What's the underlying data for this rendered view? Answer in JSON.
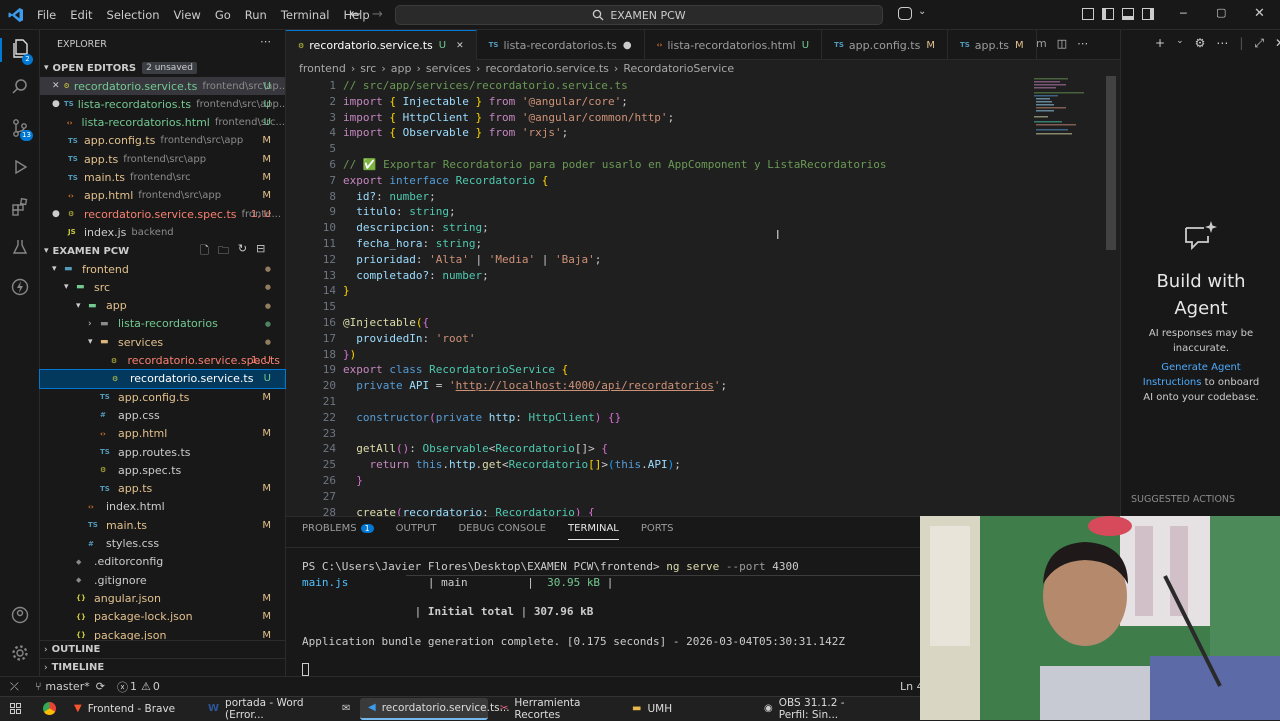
{
  "menu": [
    "File",
    "Edit",
    "Selection",
    "View",
    "Go",
    "Run",
    "Terminal",
    "Help"
  ],
  "search": {
    "text": "EXAMEN PCW"
  },
  "explorer": {
    "title": "EXPLORER",
    "open_editors": "OPEN EDITORS",
    "unsaved": "2 unsaved",
    "folder": "EXAMEN PCW",
    "outline": "OUTLINE",
    "timeline": "TIMELINE"
  },
  "open_editors": [
    {
      "name": "recordatorio.service.ts",
      "path": "frontend\\src\\ap...",
      "status": "U",
      "color": "#73c991"
    },
    {
      "name": "lista-recordatorios.ts",
      "path": "frontend\\src\\app...",
      "status": "U",
      "color": "#73c991"
    },
    {
      "name": "lista-recordatorios.html",
      "path": "frontend\\src...",
      "status": "U",
      "color": "#73c991"
    },
    {
      "name": "app.config.ts",
      "path": "frontend\\src\\app",
      "status": "M",
      "color": "#e2c08d"
    },
    {
      "name": "app.ts",
      "path": "frontend\\src\\app",
      "status": "M",
      "color": "#e2c08d"
    },
    {
      "name": "main.ts",
      "path": "frontend\\src",
      "status": "M",
      "color": "#e2c08d"
    },
    {
      "name": "app.html",
      "path": "frontend\\src\\app",
      "status": "M",
      "color": "#e2c08d"
    },
    {
      "name": "recordatorio.service.spec.ts",
      "path": "fronte...",
      "status": "1, U",
      "color": "#f88070"
    },
    {
      "name": "index.js",
      "path": "backend",
      "status": "",
      "color": "#ccc"
    }
  ],
  "tree": [
    {
      "name": "frontend",
      "indent": 1,
      "status": "",
      "color": "#e2c08d"
    },
    {
      "name": "src",
      "indent": 2,
      "status": "",
      "color": "#e2c08d"
    },
    {
      "name": "app",
      "indent": 3,
      "status": "",
      "color": "#e2c08d"
    },
    {
      "name": "lista-recordatorios",
      "indent": 4,
      "status": "",
      "color": "#73c991"
    },
    {
      "name": "services",
      "indent": 4,
      "status": "",
      "color": "#e2c08d"
    },
    {
      "name": "recordatorio.service.spec.ts",
      "indent": 5,
      "status": "1, U",
      "color": "#f88070"
    },
    {
      "name": "recordatorio.service.ts",
      "indent": 5,
      "status": "U",
      "color": "#73c991"
    },
    {
      "name": "app.config.ts",
      "indent": 4,
      "status": "M",
      "color": "#e2c08d"
    },
    {
      "name": "app.css",
      "indent": 4,
      "status": "",
      "color": "#ccc"
    },
    {
      "name": "app.html",
      "indent": 4,
      "status": "M",
      "color": "#e2c08d"
    },
    {
      "name": "app.routes.ts",
      "indent": 4,
      "status": "",
      "color": "#ccc"
    },
    {
      "name": "app.spec.ts",
      "indent": 4,
      "status": "",
      "color": "#ccc"
    },
    {
      "name": "app.ts",
      "indent": 4,
      "status": "M",
      "color": "#e2c08d"
    },
    {
      "name": "index.html",
      "indent": 3,
      "status": "",
      "color": "#ccc"
    },
    {
      "name": "main.ts",
      "indent": 3,
      "status": "M",
      "color": "#e2c08d"
    },
    {
      "name": "styles.css",
      "indent": 3,
      "status": "",
      "color": "#ccc"
    },
    {
      "name": ".editorconfig",
      "indent": 2,
      "status": "",
      "color": "#ccc"
    },
    {
      "name": ".gitignore",
      "indent": 2,
      "status": "",
      "color": "#ccc"
    },
    {
      "name": "angular.json",
      "indent": 2,
      "status": "M",
      "color": "#e2c08d"
    },
    {
      "name": "package-lock.json",
      "indent": 2,
      "status": "M",
      "color": "#e2c08d"
    },
    {
      "name": "package.json",
      "indent": 2,
      "status": "M",
      "color": "#e2c08d"
    }
  ],
  "tabs": [
    {
      "label": "recordatorio.service.ts",
      "status": "U",
      "active": true
    },
    {
      "label": "lista-recordatorios.ts",
      "status": "●",
      "active": false
    },
    {
      "label": "lista-recordatorios.html",
      "status": "U",
      "active": false
    },
    {
      "label": "app.config.ts",
      "status": "M",
      "active": false
    },
    {
      "label": "app.ts",
      "status": "M",
      "active": false
    }
  ],
  "breadcrumb": [
    "frontend",
    "src",
    "app",
    "services",
    "recordatorio.service.ts",
    "RecordatorioService"
  ],
  "code_lines": [
    "<span class='cm'>// src/app/services/recordatorio.service.ts</span>",
    "<span class='kw2'>import</span> <span class='br'>{</span> <span class='vr'>Injectable</span> <span class='br'>}</span> <span class='kw2'>from</span> <span class='str'>'@angular/core'</span>;",
    "<span class='kw2'>import</span> <span class='br'>{</span> <span class='vr'>HttpClient</span> <span class='br'>}</span> <span class='kw2'>from</span> <span class='str'>'@angular/common/http'</span>;",
    "<span class='kw2'>import</span> <span class='br'>{</span> <span class='vr'>Observable</span> <span class='br'>}</span> <span class='kw2'>from</span> <span class='str'>'rxjs'</span>;",
    "",
    "<span class='cm'>// ✅ Exportar Recordatorio para poder usarlo en AppComponent y ListaRecordatorios</span>",
    "<span class='kw2'>export</span> <span class='kw'>interface</span> <span class='ty'>Recordatorio</span> <span class='br'>{</span>",
    "  <span class='vr'>id?</span>: <span class='ty'>number</span>;",
    "  <span class='vr'>titulo</span>: <span class='ty'>string</span>;",
    "  <span class='vr'>descripcion</span>: <span class='ty'>string</span>;",
    "  <span class='vr'>fecha_hora</span>: <span class='ty'>string</span>;",
    "  <span class='vr'>prioridad</span>: <span class='str'>'Alta'</span> | <span class='str'>'Media'</span> | <span class='str'>'Baja'</span>;",
    "  <span class='vr'>completado?</span>: <span class='ty'>number</span>;",
    "<span class='br'>}</span>",
    "",
    "<span class='fn'>@Injectable</span><span class='br'>(</span><span class='br2'>{</span>",
    "  <span class='vr'>providedIn</span>: <span class='str'>'root'</span>",
    "<span class='br2'>}</span><span class='br'>)</span>",
    "<span class='kw2'>export</span> <span class='kw'>class</span> <span class='ty'>RecordatorioService</span> <span class='br'>{</span>",
    "  <span class='kw'>private</span> <span class='vr'>API</span> = <span class='str'>'<u>http://localhost:4000/api/recordatorios</u>'</span>;",
    "",
    "  <span class='kw'>constructor</span><span class='br2'>(</span><span class='kw'>private</span> <span class='vr'>http</span>: <span class='ty'>HttpClient</span><span class='br2'>)</span> <span class='br2'>{}</span>",
    "",
    "  <span class='fn'>getAll</span><span class='br2'>()</span>: <span class='ty'>Observable</span>&lt;<span class='ty'>Recordatorio</span>[]&gt; <span class='br2'>{</span>",
    "    <span class='kw2'>return</span> <span class='kw'>this</span>.<span class='vr'>http</span>.<span class='fn'>get</span>&lt;<span class='ty'>Recordatorio</span><span class='br'>[]</span>&gt;<span class='br3'>(</span><span class='kw'>this</span>.<span class='vr'>API</span><span class='br3'>)</span>;",
    "  <span class='br2'>}</span>",
    "",
    "  <span class='fn'>create</span><span class='br2'>(</span><span class='vr'>recordatorio</span>: <span class='ty'>Recordatorio</span><span class='br2'>)</span> <span class='br2'>{</span>"
  ],
  "panel": {
    "tabs": [
      "PROBLEMS",
      "OUTPUT",
      "DEBUG CONSOLE",
      "TERMINAL",
      "PORTS"
    ],
    "problems_count": "1",
    "line1_prompt": "PS C:\\Users\\Javier Flores\\Desktop\\EXAMEN PCW\\frontend>",
    "line1_cmd": "ng serve",
    "line1_arg": "--port",
    "line1_val": "4300",
    "line2_a": "main.js",
    "line2_b": "| main",
    "line2_c": "|",
    "line2_d": "30.95 kB",
    "line2_e": "|",
    "line3_a": "|",
    "line3_b": "Initial total",
    "line3_c": "|",
    "line3_d": "307.96 kB",
    "line4": "Application bundle generation complete. [0.175 seconds] - 2026-03-04T05:30:31.142Z"
  },
  "chat": {
    "title": "Build with Agent",
    "desc": "AI responses may be inaccurate.",
    "link": "Generate Agent Instructions",
    "desc2": "to onboard AI onto your codebase.",
    "suggested": "SUGGESTED ACTIONS"
  },
  "status": {
    "branch": "master*",
    "errors": "1",
    "warnings": "0",
    "pos": "Ln 4"
  },
  "taskbar": [
    {
      "label": "Frontend - Brave",
      "active": false
    },
    {
      "label": "portada - Word (Error...",
      "active": false
    },
    {
      "label": "",
      "active": false
    },
    {
      "label": "recordatorio.service.ts...",
      "active": true
    },
    {
      "label": "Herramienta Recortes",
      "active": false
    },
    {
      "label": "UMH",
      "active": false
    },
    {
      "label": "OBS 31.1.2 - Perfil: Sin...",
      "active": false
    }
  ]
}
